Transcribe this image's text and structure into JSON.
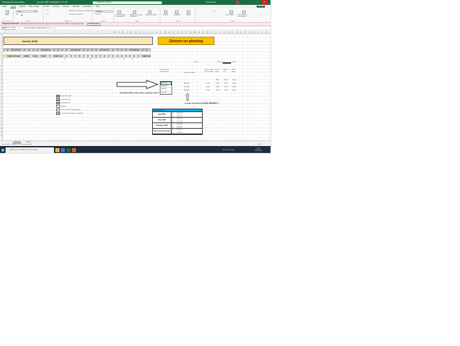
{
  "titlebar": {
    "autosave": "Enregistrement automatique",
    "docname": "gen plan 2025 - Enregistrée sur ce PC",
    "search": "Rechercher (Alt+Q)",
    "user": "Prénom Nom",
    "min": "–",
    "max": "□",
    "close": "✕"
  },
  "ribbon_tabs": [
    "Fichier",
    "Accueil",
    "Insertion",
    "Mise en page",
    "Formules",
    "Données",
    "Révision",
    "Affichage",
    "Développeur",
    "Aide"
  ],
  "ribbon_share": "Partager",
  "ribbon": {
    "paste": "Coller",
    "clipboard": "Presse-papiers",
    "font_name": "Calibri",
    "font_size": "11",
    "font_group": "Police",
    "align_group": "Alignement",
    "wrap": "Renvoyer à la ligne automatiquement",
    "merge": "Fusionner et centrer",
    "number_format": "Standard",
    "number_group": "Nombre",
    "cond_format": "Mise en forme conditionnelle",
    "as_table": "Mettre sous forme de tableau",
    "cell_styles": "Styles de cellules",
    "styles_group": "Styles",
    "insert": "Insérer",
    "delete": "Supprimer",
    "format": "Format",
    "cells_group": "Cellules",
    "sort": "Trier et filtrer",
    "find": "Rechercher et sélectionner",
    "editing_group": "Édition"
  },
  "notification": {
    "bold": "RISQUE DE SÉCURITÉ",
    "text": "Microsoft a bloqué l'exécution des macros, car la source de ce fichier n'est pas approuvée.",
    "button": "En savoir plus"
  },
  "formula_bar": {
    "name_box": "AT19",
    "fx": "fx",
    "formula": "=SIERREUR(SI(NB.SI($A$7:$NH$7;\"ND\")>0;...);\"\")"
  },
  "columns": [
    "A",
    "B",
    "C",
    "D",
    "E",
    "F",
    "G",
    "H",
    "I",
    "J",
    "K",
    "L",
    "M",
    "N",
    "O",
    "P",
    "Q",
    "R",
    "S",
    "T",
    "U",
    "V",
    "W",
    "X",
    "Y",
    "Z",
    "AA",
    "AB",
    "AC",
    "AD",
    "AE",
    "AF",
    "AG",
    "AH",
    "AI",
    "AJ",
    "AK",
    "AL",
    "AM",
    "AN",
    "AO",
    "AP",
    "AQ",
    "AR",
    "AS",
    "AT",
    "AU",
    "AV",
    "AW",
    "AX",
    "AY",
    "AZ",
    "BA",
    "BB",
    "BC",
    "BD",
    "BE",
    "BF",
    "BG",
    "BH",
    "BI",
    "BJ",
    "BK"
  ],
  "rows": [
    "1",
    "2",
    "3",
    "4",
    "5",
    "6",
    "7",
    "8",
    "9",
    "10",
    "11",
    "12",
    "13",
    "14",
    "15",
    "16",
    "17",
    "18",
    "19",
    "20",
    "21",
    "22",
    "23",
    "24",
    "25",
    "26",
    "27",
    "28",
    "29",
    "30"
  ],
  "sheet": {
    "year_title": "Année 2025",
    "generate_button": "Générer un planning",
    "days": [
      "jeu. 1",
      "ven. 2",
      "sam. 3",
      "dim. 4",
      "lun. 5",
      "mar. 6",
      "mer. 7",
      "jeu. 8",
      "ven. 9",
      "sam. 10",
      "dim. 11",
      "lun. 12",
      "mar. 13",
      "mer. 14",
      "jeu. 15",
      "ven. 16",
      "sam. 17",
      "dim. 18",
      "lun. 19",
      "mar. 20",
      "mer. 21",
      "jeu. 22",
      "ven. 23",
      "sam. 24",
      "dim. 25",
      "lun. 26",
      "mar. 27",
      "mer. 28",
      "jeu. 29",
      "ven. 30",
      "sam. 31",
      "dim. 32",
      "lun. 33",
      "mar. 34",
      "mer. 35"
    ],
    "codes": [
      "",
      "M",
      "S",
      "N",
      "",
      "M",
      "",
      "S",
      "",
      "N",
      "",
      "",
      "M",
      "S",
      "",
      "",
      "",
      "",
      "",
      "",
      "",
      "",
      "",
      "",
      "",
      "",
      "",
      "",
      "",
      "",
      "",
      "",
      "",
      "M",
      "S"
    ],
    "red_marks": [
      "x",
      "x",
      "x",
      "x"
    ],
    "legend": [
      {
        "code": "M",
        "label": "poste du matin",
        "color": "#92d050"
      },
      {
        "code": "S",
        "label": "poste du soir",
        "color": "#f4b183"
      },
      {
        "code": "N",
        "label": "poste de nuit",
        "color": "#9dc3e6"
      },
      {
        "code": "",
        "label": "Repos",
        "color": "#ffffff"
      },
      {
        "code": "",
        "label": "nuit en heures supp. payées",
        "color": "#ffffff"
      },
      {
        "code": "RTT",
        "label": "nuit en heures supp. récupérées",
        "color": "#ffffff"
      }
    ],
    "question1": "Comment faire des cases comme cela ?",
    "question2": "A quoi correspond 2025-02/03/05 ?",
    "taux_label": "Taux d :",
    "taux_value": "2,13 ht",
    "taux_value2": "8,00 h",
    "semaines_header": "Semaines avec heures de nuit",
    "semaines_uniques_header": "Semaines uniques",
    "heures_sup_header": "Heures supp. de la semaine",
    "heures_total_header": "Heures totale",
    "heures_nuit_header": "Heures nuit",
    "heures_repos_header": "Heures totale",
    "week_cells": [
      "2025-02",
      "2025-03",
      "2025-05",
      "2025-05"
    ],
    "week_unique": [
      "2025-02",
      "2025-03",
      "2025-05"
    ],
    "heures_col1": [
      "a.m/n",
      "a.m/n",
      "a.m/n"
    ],
    "num_row0": [
      "336 h",
      "125 h",
      "3,50 h"
    ],
    "num_rows": [
      [
        "0,75 h",
        "7,25 h",
        "0,00 h"
      ],
      [
        "0,75 h",
        "7,25 h",
        "0,00 h"
      ],
      [
        "0,75 h",
        "7,25 h",
        "8,00 h"
      ]
    ],
    "hol_header": [
      "Périodes vacances",
      "",
      ""
    ],
    "holidays": [
      {
        "name": "Noël 2024",
        "from_label": "Du",
        "to_label": "au",
        "from": "##########",
        "to": "##########"
      },
      {
        "name": "Hiver 2025",
        "from_label": "Du",
        "to_label": "au",
        "from": "##########",
        "to": "##########"
      },
      {
        "name": "Printemps 2025",
        "from_label": "Du",
        "to_label": "au",
        "from": "##########",
        "to": "21 avr. 2025"
      },
      {
        "name": "Pont Ascension 2025",
        "from_label": "Du",
        "to_label": "au",
        "from": "##########",
        "to": "##########"
      }
    ]
  },
  "sheet_tabs": [
    "Planning",
    "JOURS"
  ],
  "status": {
    "left": "Accessibilité : consultez nos recommandations",
    "zoom": "100 %"
  },
  "taskbar": {
    "search": "Tapez ici pour effectuer une recherche",
    "weather": "15°C Ciel couvert",
    "time": "10:16",
    "date": "19/10/2024"
  }
}
